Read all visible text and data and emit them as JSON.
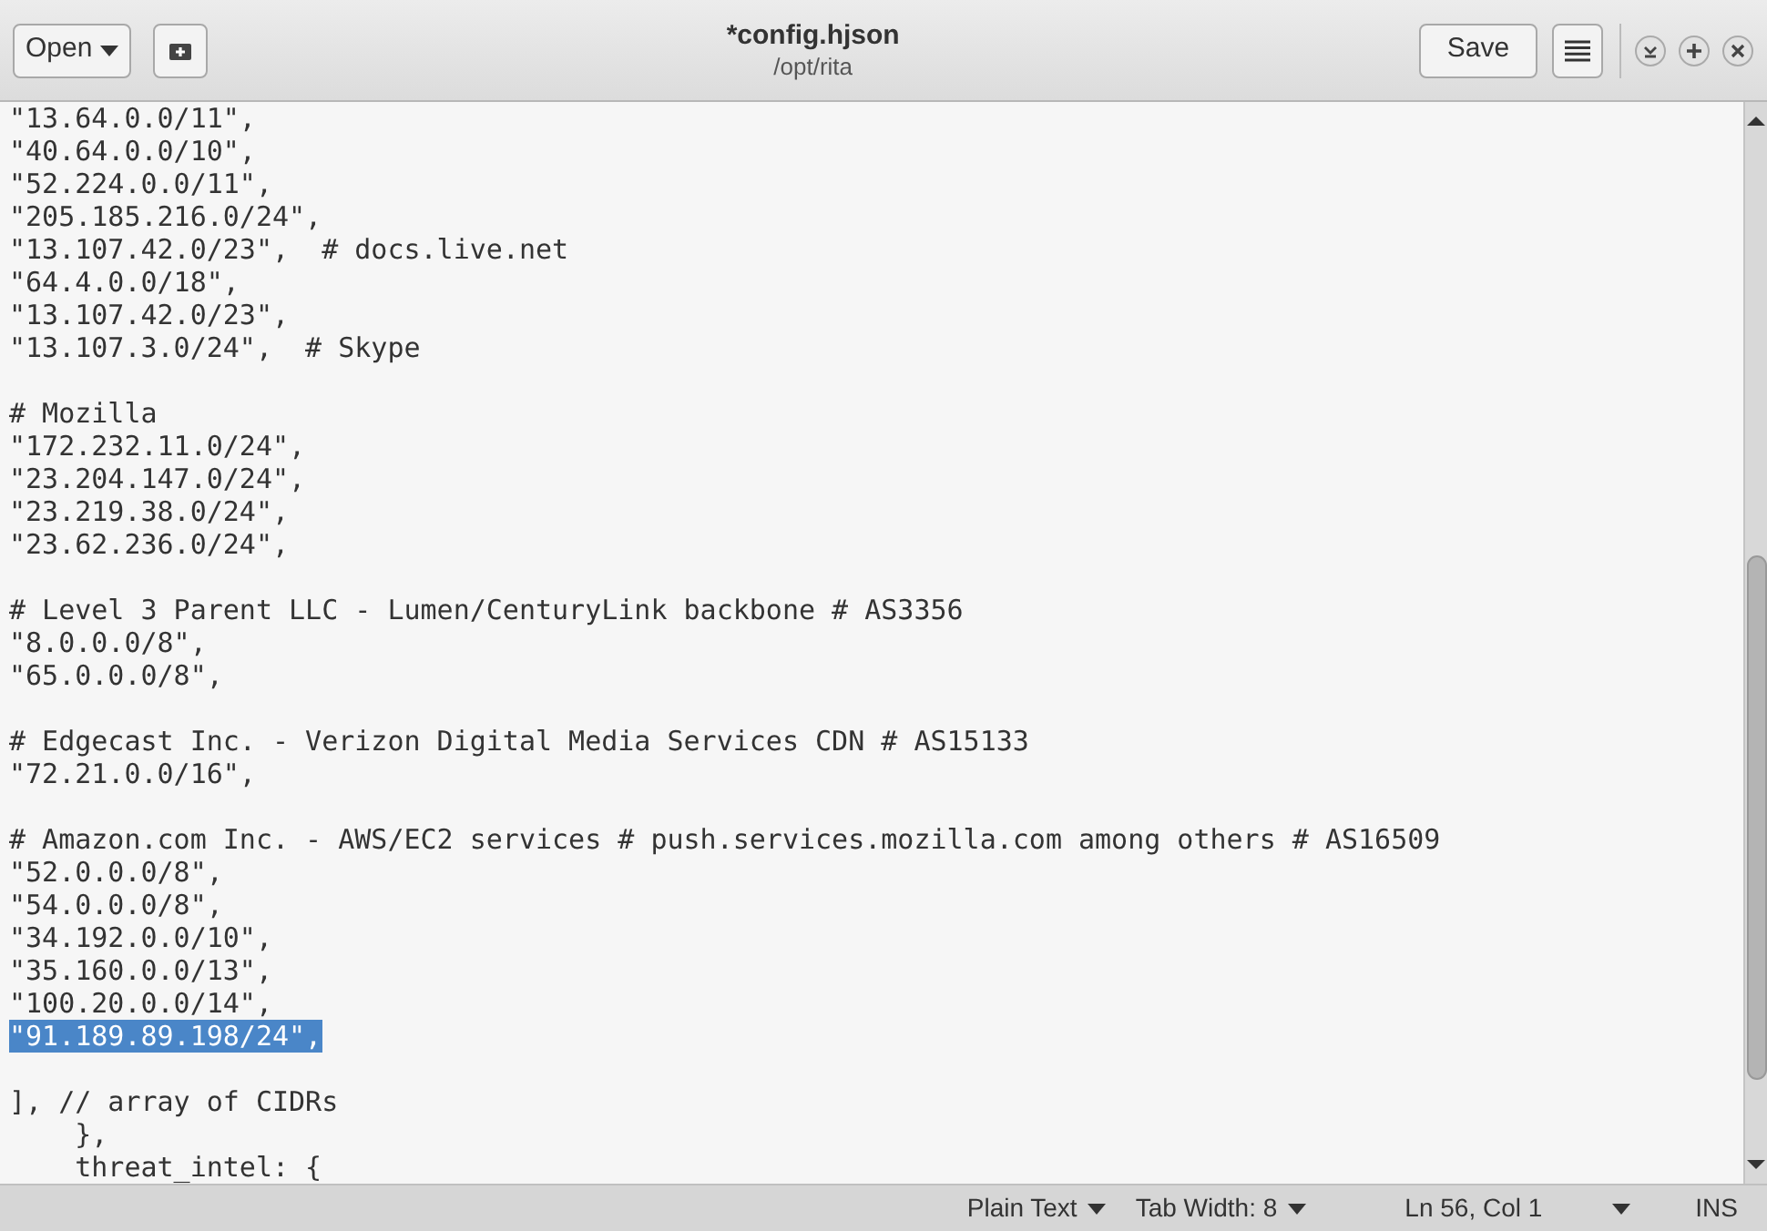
{
  "header": {
    "open_button": "Open",
    "title": "*config.hjson",
    "subtitle": "/opt/rita",
    "save_button": "Save"
  },
  "editor": {
    "blocks": [
      {
        "lines": [
          {
            "text": "\"13.64.0.0/11\",",
            "selected": false
          },
          {
            "text": "\"40.64.0.0/10\",",
            "selected": false
          },
          {
            "text": "\"52.224.0.0/11\",",
            "selected": false
          },
          {
            "text": "\"205.185.216.0/24\",",
            "selected": false
          },
          {
            "text": "\"13.107.42.0/23\",  # docs.live.net",
            "selected": false
          },
          {
            "text": "\"64.4.0.0/18\",",
            "selected": false
          },
          {
            "text": "\"13.107.42.0/23\",",
            "selected": false
          },
          {
            "text": "\"13.107.3.0/24\",  # Skype",
            "selected": false
          }
        ]
      },
      {
        "lines": [
          {
            "text": "# Mozilla",
            "selected": false
          },
          {
            "text": "\"172.232.11.0/24\",",
            "selected": false
          },
          {
            "text": "\"23.204.147.0/24\",",
            "selected": false
          },
          {
            "text": "\"23.219.38.0/24\",",
            "selected": false
          },
          {
            "text": "\"23.62.236.0/24\",",
            "selected": false
          }
        ]
      },
      {
        "lines": [
          {
            "text": "# Level 3 Parent LLC - Lumen/CenturyLink backbone # AS3356",
            "selected": false
          },
          {
            "text": "\"8.0.0.0/8\",",
            "selected": false
          },
          {
            "text": "\"65.0.0.0/8\",",
            "selected": false
          }
        ]
      },
      {
        "lines": [
          {
            "text": "# Edgecast Inc. - Verizon Digital Media Services CDN # AS15133",
            "selected": false
          },
          {
            "text": "\"72.21.0.0/16\",",
            "selected": false
          }
        ]
      },
      {
        "lines": [
          {
            "text": "# Amazon.com Inc. - AWS/EC2 services # push.services.mozilla.com among others # AS16509",
            "selected": false
          },
          {
            "text": "\"52.0.0.0/8\",",
            "selected": false
          },
          {
            "text": "\"54.0.0.0/8\",",
            "selected": false
          },
          {
            "text": "\"34.192.0.0/10\",",
            "selected": false
          },
          {
            "text": "\"35.160.0.0/13\",",
            "selected": false
          },
          {
            "text": "\"100.20.0.0/14\",",
            "selected": false
          },
          {
            "text": "\"91.189.89.198/24\",",
            "selected": true
          }
        ]
      },
      {
        "lines": [
          {
            "text": "], // array of CIDRs",
            "selected": false
          },
          {
            "text": "    },",
            "selected": false
          },
          {
            "text": "    threat_intel: {",
            "selected": false
          }
        ]
      }
    ]
  },
  "status_bar": {
    "language": "Plain Text",
    "tab_width": "Tab Width: 8",
    "position": "Ln 56, Col 1",
    "mode": "INS"
  }
}
